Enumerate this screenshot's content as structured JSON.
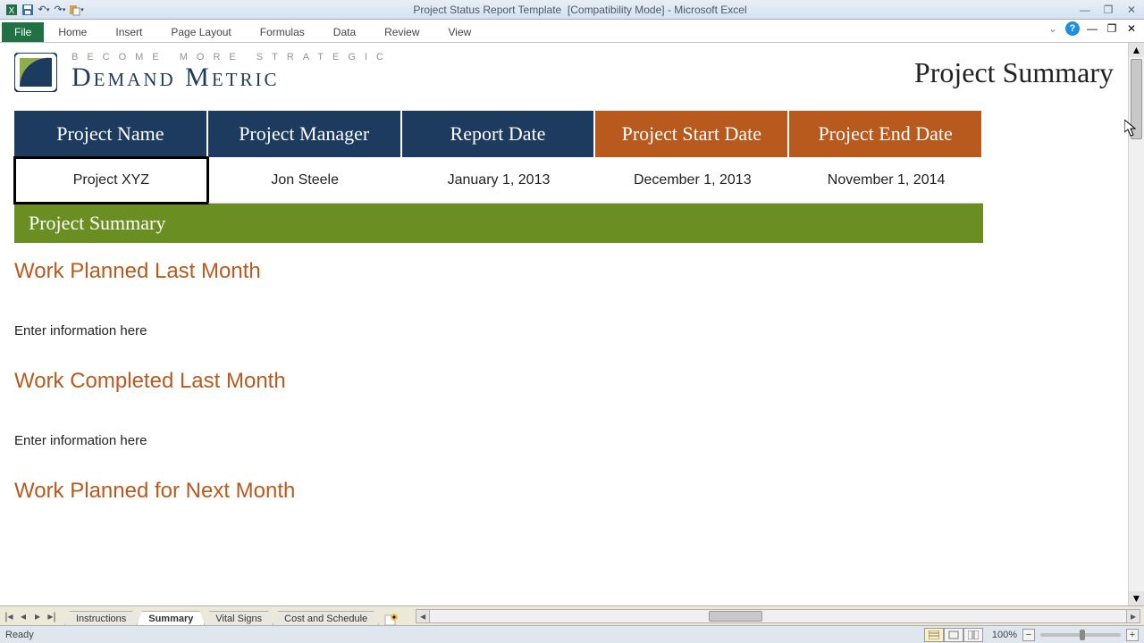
{
  "window": {
    "title_doc": "Project Status Report Template",
    "title_mode": "[Compatibility Mode]",
    "title_app": "Microsoft Excel"
  },
  "ribbon": {
    "file": "File",
    "tabs": [
      "Home",
      "Insert",
      "Page Layout",
      "Formulas",
      "Data",
      "Review",
      "View"
    ]
  },
  "brand": {
    "tagline": "Become More Strategic",
    "name": "Demand Metric",
    "page_title": "Project Summary"
  },
  "info": {
    "headers": [
      "Project Name",
      "Project Manager",
      "Report Date",
      "Project Start Date",
      "Project End Date"
    ],
    "values": [
      "Project XYZ",
      "Jon Steele",
      "January 1, 2013",
      "December 1, 2013",
      "November 1, 2014"
    ]
  },
  "green_bar": "Project Summary",
  "sections": [
    {
      "title": "Work Planned Last Month",
      "body": "Enter information here"
    },
    {
      "title": "Work Completed Last Month",
      "body": "Enter information here"
    },
    {
      "title": "Work Planned for Next Month",
      "body": ""
    }
  ],
  "sheet_tabs": [
    "Instructions",
    "Summary",
    "Vital Signs",
    "Cost and Schedule"
  ],
  "active_sheet": 1,
  "status": {
    "ready": "Ready",
    "zoom": "100%"
  }
}
